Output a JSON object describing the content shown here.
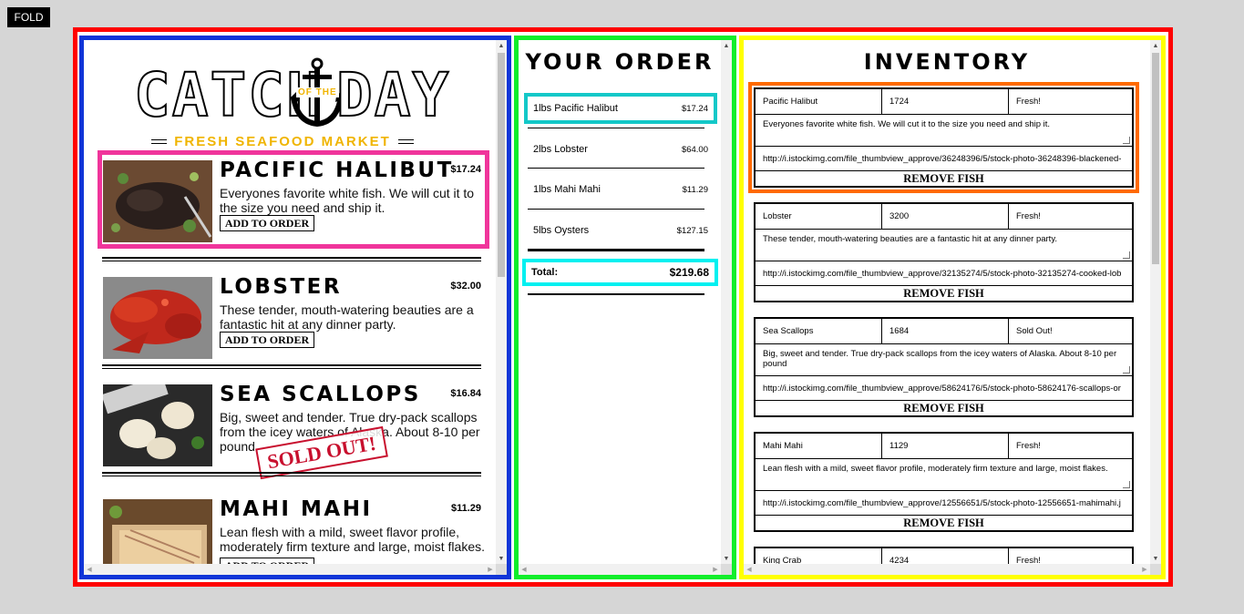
{
  "fold_label": "FOLD",
  "menu": {
    "logo_left": "CATCH",
    "logo_of_the": "OF THE",
    "logo_right": "DAY",
    "tagline": "FRESH SEAFOOD MARKET",
    "add_label": "ADD TO ORDER",
    "sold_out_label": "SOLD OUT!",
    "items": [
      {
        "name": "Pacific Halibut",
        "price": "$17.24",
        "desc": "Everyones favorite white fish. We will cut it to the size you need and ship it."
      },
      {
        "name": "Lobster",
        "price": "$32.00",
        "desc": "These tender, mouth-watering beauties are a fantastic hit at any dinner party."
      },
      {
        "name": "Sea Scallops",
        "price": "$16.84",
        "desc": "Big, sweet and tender. True dry-pack scallops from the icey waters of Alaska. About 8-10 per pound"
      },
      {
        "name": "Mahi Mahi",
        "price": "$11.29",
        "desc": "Lean flesh with a mild, sweet flavor profile, moderately firm texture and large, moist flakes."
      }
    ]
  },
  "order": {
    "title": "YOUR ORDER",
    "lines": [
      {
        "label": "1lbs Pacific Halibut",
        "price": "$17.24"
      },
      {
        "label": "2lbs Lobster",
        "price": "$64.00"
      },
      {
        "label": "1lbs Mahi Mahi",
        "price": "$11.29"
      },
      {
        "label": "5lbs Oysters",
        "price": "$127.15"
      }
    ],
    "total_label": "Total:",
    "total_value": "$219.68"
  },
  "inventory": {
    "title": "INVENTORY",
    "remove_label": "REMOVE FISH",
    "items": [
      {
        "name": "Pacific Halibut",
        "price": "1724",
        "status": "Fresh!",
        "desc": "Everyones favorite white fish. We will cut it to the size you need and ship it.",
        "image": "http://i.istockimg.com/file_thumbview_approve/36248396/5/stock-photo-36248396-blackened-"
      },
      {
        "name": "Lobster",
        "price": "3200",
        "status": "Fresh!",
        "desc": "These tender, mouth-watering beauties are a fantastic hit at any dinner party.",
        "image": "http://i.istockimg.com/file_thumbview_approve/32135274/5/stock-photo-32135274-cooked-lob"
      },
      {
        "name": "Sea Scallops",
        "price": "1684",
        "status": "Sold Out!",
        "desc": "Big, sweet and tender. True dry-pack scallops from the icey waters of Alaska. About 8-10 per pound",
        "image": "http://i.istockimg.com/file_thumbview_approve/58624176/5/stock-photo-58624176-scallops-or"
      },
      {
        "name": "Mahi Mahi",
        "price": "1129",
        "status": "Fresh!",
        "desc": "Lean flesh with a mild, sweet flavor profile, moderately firm texture and large, moist flakes.",
        "image": "http://i.istockimg.com/file_thumbview_approve/12556651/5/stock-photo-12556651-mahimahi.j"
      },
      {
        "name": "King Crab",
        "price": "4234",
        "status": "Fresh!"
      }
    ]
  },
  "colors": {
    "outer_border": "#ff0000",
    "menu_border": "#1035d8",
    "order_border": "#11ee2b",
    "inventory_border": "#ffff00",
    "selected_menu_item": "#f0359b",
    "selected_inventory_item": "#ff6a00",
    "order_highlight": "#13c8c8",
    "total_highlight": "#00f0f0",
    "accent_gold": "#f0b400",
    "sold_out_red": "#c8102e"
  }
}
